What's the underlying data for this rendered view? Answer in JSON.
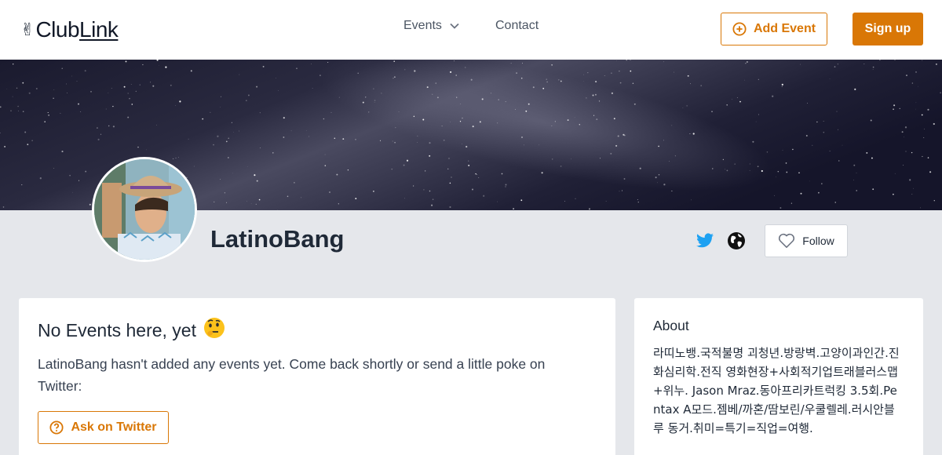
{
  "header": {
    "logo_text_plain": "Club",
    "logo_text_underlined": "Link",
    "nav": {
      "events_label": "Events",
      "contact_label": "Contact"
    },
    "add_event_label": "Add Event",
    "signup_label": "Sign up"
  },
  "profile": {
    "name": "LatinoBang",
    "follow_label": "Follow"
  },
  "events_card": {
    "title": "No Events here, yet",
    "emoji": "🤔",
    "message": "LatinoBang hasn't added any events yet. Come back shortly or send a little poke on Twitter:",
    "ask_button_label": "Ask on Twitter"
  },
  "about_card": {
    "title": "About",
    "text": "라띠노뱅.국적불명 괴청년.방랑벽.고양이과인간.진화심리학.전직 영화현장+사회적기업트래블러스맵+위누. Jason Mraz.동아프리카트럭킹 3.5회.Pentax A모드.젬베/까혼/땀보린/우쿨렐레.러시안블루 동거.취미=특기=직업=여행."
  },
  "colors": {
    "accent": "#d97706",
    "page_bg": "#e5e7eb",
    "twitter": "#1da1f2"
  },
  "icons": [
    "victory-hand-icon",
    "chevron-down-icon",
    "plus-circle-icon",
    "twitter-icon",
    "globe-icon",
    "heart-icon",
    "thinking-face-icon",
    "question-circle-icon"
  ]
}
